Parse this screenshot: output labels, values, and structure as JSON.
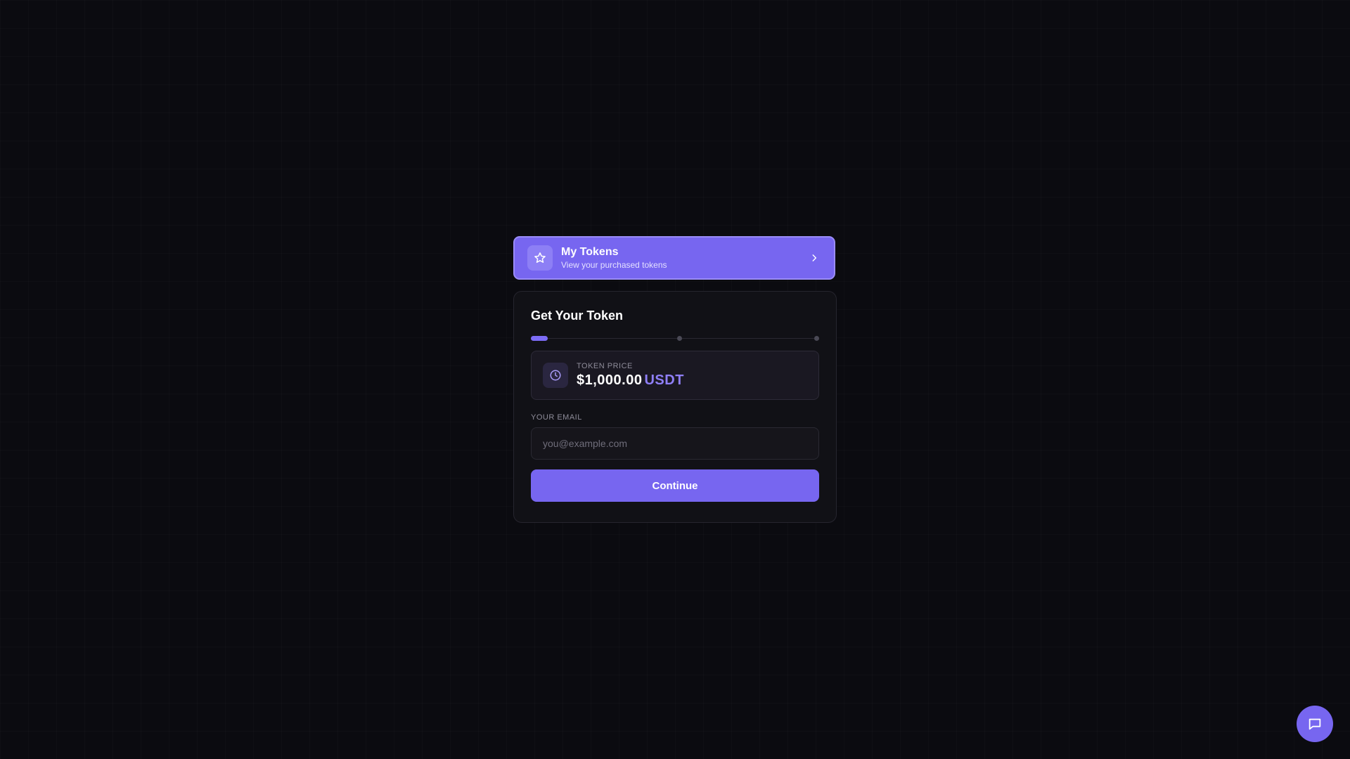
{
  "tokens_banner": {
    "title": "My Tokens",
    "subtitle": "View your purchased tokens",
    "icon": "star-icon",
    "chevron_icon": "chevron-right-icon"
  },
  "card": {
    "title": "Get Your Token",
    "stepper": {
      "steps_total": 3,
      "current_step": 1
    },
    "price": {
      "label": "TOKEN PRICE",
      "amount": "$1,000.00",
      "currency": "USDT",
      "icon": "clock-icon"
    },
    "email": {
      "label": "YOUR EMAIL",
      "value": "",
      "placeholder": "you@example.com"
    },
    "continue_label": "Continue"
  },
  "chat": {
    "icon": "chat-bubble-icon"
  },
  "colors": {
    "accent": "#7766f0",
    "accent_light": "#8f7ff7",
    "background": "#0b0b10",
    "card": "#111116"
  }
}
